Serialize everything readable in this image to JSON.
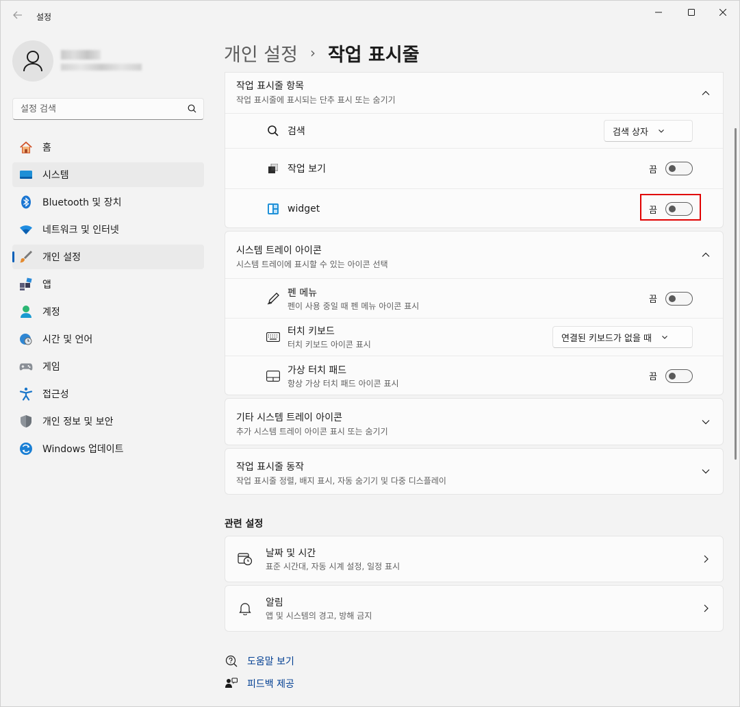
{
  "app": {
    "title": "설정"
  },
  "search": {
    "placeholder": "설정 검색"
  },
  "sidebar": {
    "items": [
      {
        "label": "홈",
        "icon": "home-icon"
      },
      {
        "label": "시스템",
        "icon": "system-icon"
      },
      {
        "label": "Bluetooth 및 장치",
        "icon": "bluetooth-icon"
      },
      {
        "label": "네트워크 및 인터넷",
        "icon": "wifi-icon"
      },
      {
        "label": "개인 설정",
        "icon": "brush-icon"
      },
      {
        "label": "앱",
        "icon": "apps-icon"
      },
      {
        "label": "계정",
        "icon": "account-icon"
      },
      {
        "label": "시간 및 언어",
        "icon": "time-language-icon"
      },
      {
        "label": "게임",
        "icon": "gamepad-icon"
      },
      {
        "label": "접근성",
        "icon": "accessibility-icon"
      },
      {
        "label": "개인 정보 및 보안",
        "icon": "shield-icon"
      },
      {
        "label": "Windows 업데이트",
        "icon": "update-icon"
      }
    ]
  },
  "breadcrumb": {
    "parent": "개인 설정",
    "separator": "›",
    "current": "작업 표시줄"
  },
  "taskbar_items": {
    "title": "작업 표시줄 항목",
    "subtitle": "작업 표시줄에 표시되는 단추 표시 또는 숨기기",
    "rows": {
      "search": {
        "title": "검색",
        "value": "검색 상자"
      },
      "task_view": {
        "title": "작업 보기",
        "state": "끔"
      },
      "widget": {
        "title": "widget",
        "state": "끔"
      }
    }
  },
  "system_tray": {
    "title": "시스템 트레이 아이콘",
    "subtitle": "시스템 트레이에 표시할 수 있는 아이콘 선택",
    "rows": {
      "pen": {
        "title": "펜 메뉴",
        "sub": "펜이 사용 중일 때 펜 메뉴 아이콘 표시",
        "state": "끔"
      },
      "touch_keyboard": {
        "title": "터치 키보드",
        "sub": "터치 키보드 아이콘 표시",
        "value": "연결된 키보드가 없을 때"
      },
      "touchpad": {
        "title": "가상 터치 패드",
        "sub": "항상 가상 터치 패드 아이콘 표시",
        "state": "끔"
      }
    }
  },
  "other_tray": {
    "title": "기타 시스템 트레이 아이콘",
    "subtitle": "추가 시스템 트레이 아이콘 표시 또는 숨기기"
  },
  "behaviors": {
    "title": "작업 표시줄 동작",
    "subtitle": "작업 표시줄 정렬, 배지 표시, 자동 숨기기 및 다중 디스플레이"
  },
  "related": {
    "title": "관련 설정",
    "items": [
      {
        "title": "날짜 및 시간",
        "sub": "표준 시간대, 자동 시계 설정, 일정 표시"
      },
      {
        "title": "알림",
        "sub": "앱 및 시스템의 경고, 방해 금지"
      }
    ]
  },
  "help": {
    "get_help": "도움말 보기",
    "feedback": "피드백 제공"
  },
  "colors": {
    "accent": "#005fb8",
    "highlight": "#e00000"
  }
}
